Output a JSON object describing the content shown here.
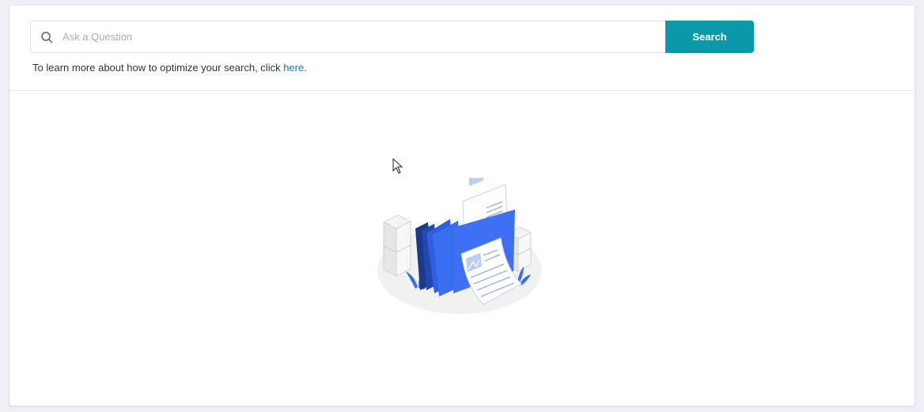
{
  "search": {
    "placeholder": "Ask a Question",
    "value": "",
    "button_label": "Search",
    "icon": "search-icon"
  },
  "hint": {
    "text": "To learn more about how to optimize your search, click ",
    "link_label": "here",
    "suffix": "."
  },
  "illustration": {
    "icon": "empty-documents-illustration"
  },
  "colors": {
    "accent": "#0b98a8",
    "link": "#1d70b8",
    "illustration_blue": "#2f5fe0"
  }
}
